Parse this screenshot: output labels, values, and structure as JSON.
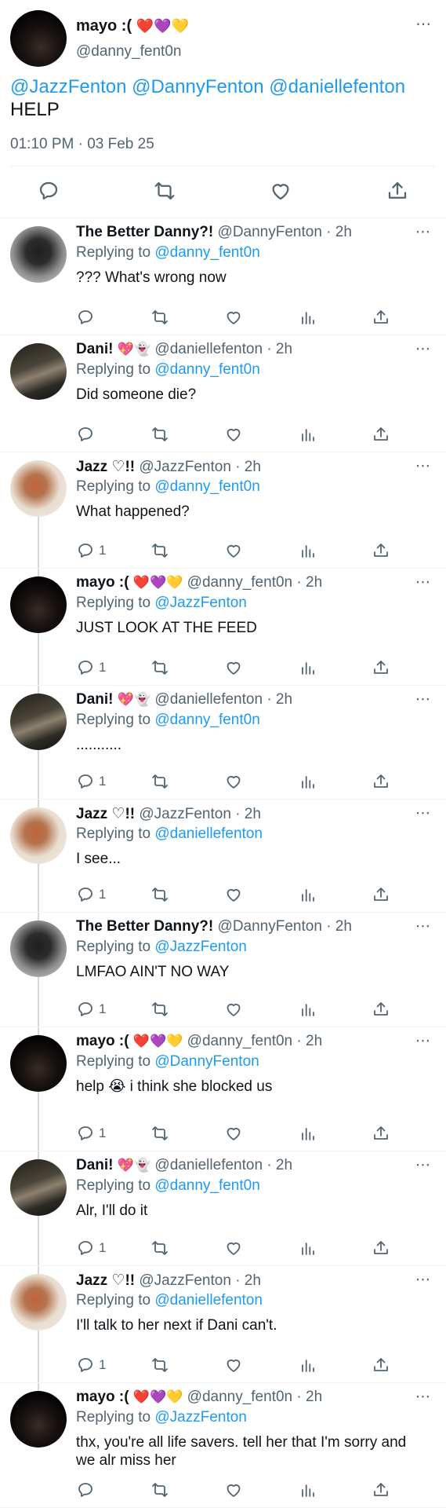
{
  "main_tweet": {
    "display_name": "mayo :(",
    "name_emojis": "❤️💜💛",
    "handle": "@danny_fent0n",
    "more_icon": "⋯",
    "mentions": "@JazzFenton @DannyFenton @daniellefenton",
    "text": "HELP",
    "timestamp": "01:10 PM · 03 Feb 25"
  },
  "colors": {
    "accent": "#1d9bf0",
    "secondary_text": "#536471",
    "text": "#0f1419",
    "divider": "#eff3f4",
    "thread_line": "#cfd9de"
  },
  "replies": [
    {
      "name": "The Better Danny?!",
      "emojis": "",
      "handle": "@DannyFenton",
      "time": "· 2h",
      "replying_label": "Replying to",
      "replying_to": "@danny_fent0n",
      "text": "??? What's wrong now",
      "reply_count": "",
      "avatar": "danny",
      "has_line_above": false,
      "has_line_below": false
    },
    {
      "name": "Dani!",
      "emojis": "💖👻",
      "handle": "@daniellefenton",
      "time": "· 2h",
      "replying_label": "Replying to",
      "replying_to": "@danny_fent0n",
      "text": "Did someone die?",
      "reply_count": "",
      "avatar": "dani",
      "has_line_above": false,
      "has_line_below": false
    },
    {
      "name": "Jazz ♡!!",
      "emojis": "",
      "handle": "@JazzFenton",
      "time": "· 2h",
      "replying_label": "Replying to",
      "replying_to": "@danny_fent0n",
      "text": "What happened?",
      "reply_count": "1",
      "avatar": "jazz",
      "has_line_above": false,
      "has_line_below": true
    },
    {
      "name": "mayo :(",
      "emojis": "❤️💜💛",
      "handle": "@danny_fent0n",
      "time": "· 2h",
      "replying_label": "Replying to",
      "replying_to": "@JazzFenton",
      "text": "JUST LOOK AT THE FEED",
      "reply_count": "1",
      "avatar": "mayo",
      "has_line_above": true,
      "has_line_below": true
    },
    {
      "name": "Dani!",
      "emojis": "💖👻",
      "handle": "@daniellefenton",
      "time": "· 2h",
      "replying_label": "Replying to",
      "replying_to": "@danny_fent0n",
      "text": "...........",
      "reply_count": "1",
      "avatar": "dani",
      "has_line_above": true,
      "has_line_below": true
    },
    {
      "name": "Jazz ♡!!",
      "emojis": "",
      "handle": "@JazzFenton",
      "time": "· 2h",
      "replying_label": "Replying to",
      "replying_to": "@daniellefenton",
      "text": "I see...",
      "reply_count": "1",
      "avatar": "jazz",
      "has_line_above": true,
      "has_line_below": true
    },
    {
      "name": "The Better Danny?!",
      "emojis": "",
      "handle": "@DannyFenton",
      "time": "· 2h",
      "replying_label": "Replying to",
      "replying_to": "@JazzFenton",
      "text": "LMFAO AIN'T NO WAY",
      "reply_count": "1",
      "avatar": "danny",
      "has_line_above": true,
      "has_line_below": true
    },
    {
      "name": "mayo :(",
      "emojis": "❤️💜💛",
      "handle": "@danny_fent0n",
      "time": "· 2h",
      "replying_label": "Replying to",
      "replying_to": "@DannyFenton",
      "text": "help 😭  i think she blocked us",
      "reply_count": "1",
      "avatar": "mayo",
      "has_line_above": true,
      "has_line_below": true
    },
    {
      "name": "Dani!",
      "emojis": "💖👻",
      "handle": "@daniellefenton",
      "time": "· 2h",
      "replying_label": "Replying to",
      "replying_to": "@danny_fent0n",
      "text": "Alr, I'll do it",
      "reply_count": "1",
      "avatar": "dani",
      "has_line_above": true,
      "has_line_below": true
    },
    {
      "name": "Jazz ♡!!",
      "emojis": "",
      "handle": "@JazzFenton",
      "time": "· 2h",
      "replying_label": "Replying to",
      "replying_to": "@daniellefenton",
      "text": "I'll talk to her next if Dani can't.",
      "reply_count": "1",
      "avatar": "jazz",
      "has_line_above": true,
      "has_line_below": true
    },
    {
      "name": "mayo :(",
      "emojis": "❤️💜💛",
      "handle": "@danny_fent0n",
      "time": "· 2h",
      "replying_label": "Replying to",
      "replying_to": "@JazzFenton",
      "text": "thx, you're all life savers. tell her that I'm sorry and we alr miss her",
      "reply_count": "",
      "avatar": "mayo",
      "has_line_above": true,
      "has_line_below": false
    }
  ]
}
